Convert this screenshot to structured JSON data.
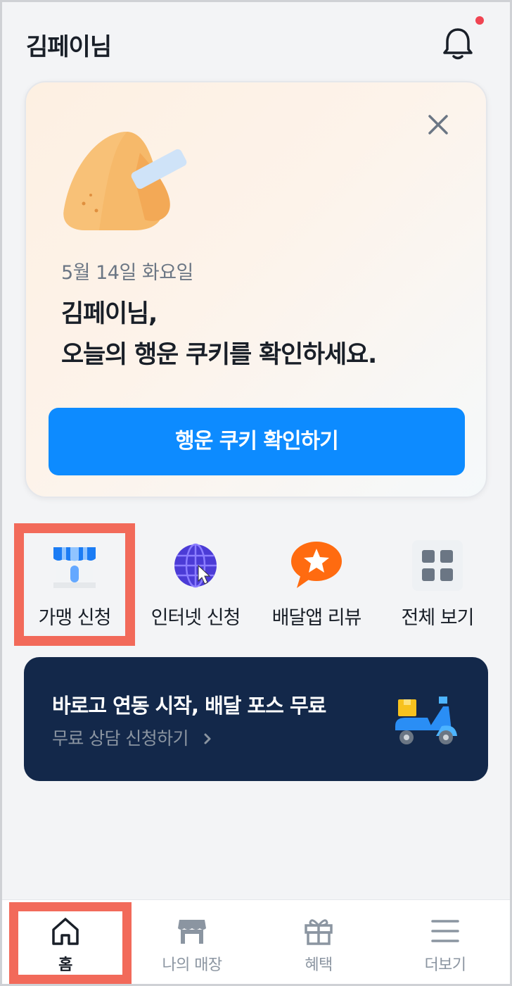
{
  "header": {
    "greeting": "김페이님",
    "notification_icon": "bell-icon",
    "has_unread": true
  },
  "fortune_card": {
    "close_icon": "close-icon",
    "date": "5월 14일 화요일",
    "title_line1": "김페이님,",
    "title_line2": "오늘의 행운 쿠키를 확인하세요.",
    "cta_label": "행운 쿠키 확인하기"
  },
  "quick_menu": [
    {
      "label": "가맹 신청",
      "icon": "store-icon"
    },
    {
      "label": "인터넷 신청",
      "icon": "globe-icon"
    },
    {
      "label": "배달앱 리뷰",
      "icon": "review-star-icon"
    },
    {
      "label": "전체 보기",
      "icon": "grid-icon"
    }
  ],
  "promo_banner": {
    "title": "바로고 연동 시작, 배달 포스 무료",
    "subtitle": "무료 상담 신청하기",
    "icon": "scooter-icon"
  },
  "bottom_nav": [
    {
      "label": "홈",
      "icon": "home-icon",
      "active": true
    },
    {
      "label": "나의 매장",
      "icon": "store-icon",
      "active": false
    },
    {
      "label": "혜택",
      "icon": "gift-icon",
      "active": false
    },
    {
      "label": "더보기",
      "icon": "menu-icon",
      "active": false
    }
  ],
  "colors": {
    "primary": "#0d8bff",
    "banner_bg": "#13284a",
    "highlight": "#f26a5a",
    "notification_dot": "#f04452"
  }
}
